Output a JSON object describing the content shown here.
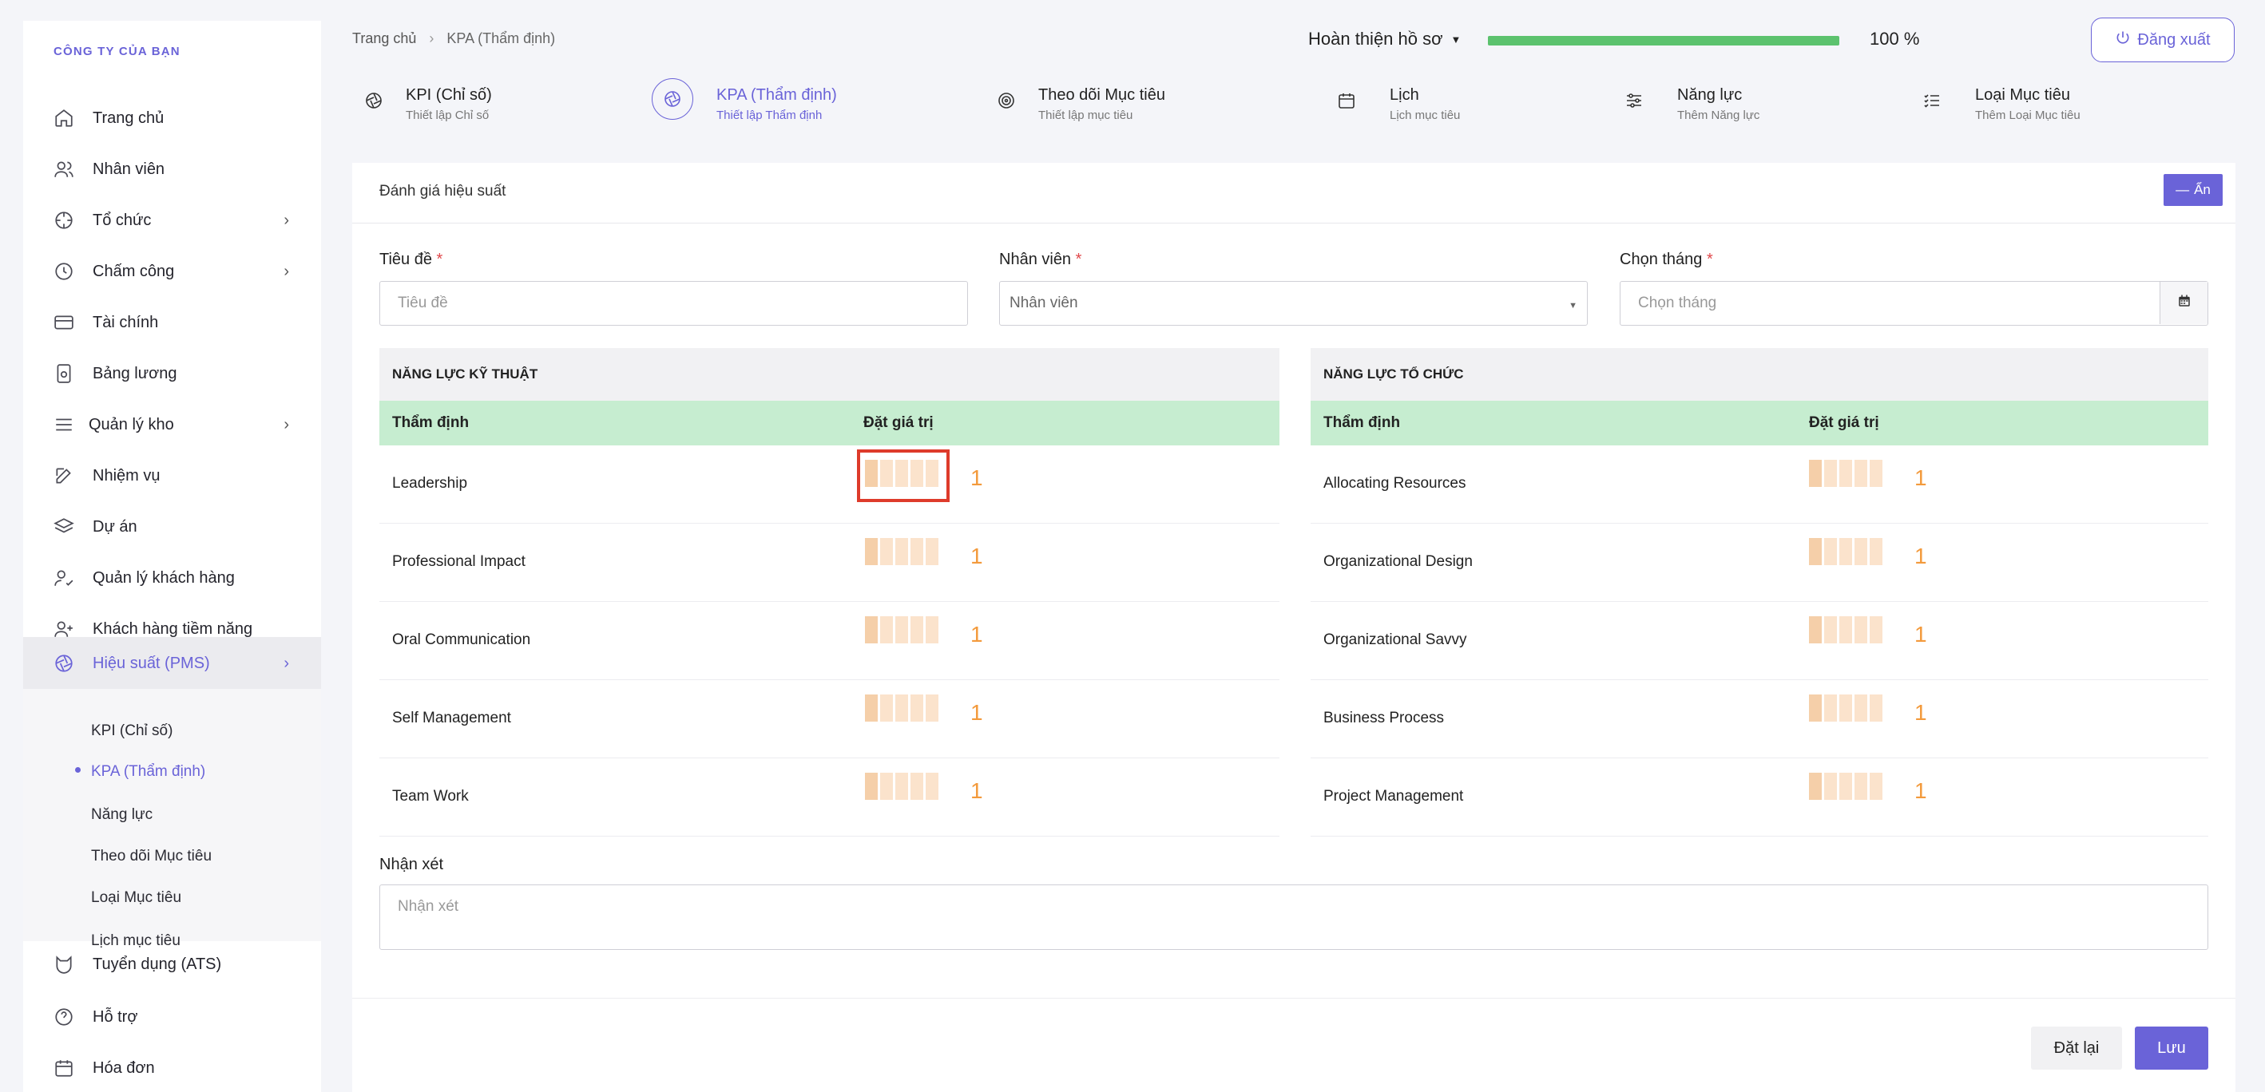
{
  "sidebar": {
    "company": "CÔNG TY CỦA BẠN",
    "items": [
      {
        "label": "Trang chủ"
      },
      {
        "label": "Nhân viên"
      },
      {
        "label": "Tổ chức"
      },
      {
        "label": "Chấm công"
      },
      {
        "label": "Tài chính"
      },
      {
        "label": "Bảng lương"
      },
      {
        "label": "Quản lý kho"
      },
      {
        "label": "Nhiệm vụ"
      },
      {
        "label": "Dự án"
      },
      {
        "label": "Quản lý khách hàng"
      },
      {
        "label": "Khách hàng tiềm năng"
      },
      {
        "label": "Hiệu suất (PMS)"
      },
      {
        "label": "Tuyển dụng (ATS)"
      },
      {
        "label": "Hỗ trợ"
      },
      {
        "label": "Hóa đơn"
      }
    ],
    "submenu": [
      {
        "label": "KPI (Chỉ số)"
      },
      {
        "label": "KPA (Thẩm định)"
      },
      {
        "label": "Năng lực"
      },
      {
        "label": "Theo dõi Mục tiêu"
      },
      {
        "label": "Loại Mục tiêu"
      },
      {
        "label": "Lịch mục tiêu"
      }
    ]
  },
  "header": {
    "breadcrumb": {
      "home": "Trang chủ",
      "current": "KPA (Thẩm định)"
    },
    "profile_label": "Hoàn thiện hồ sơ",
    "progress_value": 100,
    "progress_text": "100 %",
    "logout_label": "Đăng xuất"
  },
  "tabs": [
    {
      "title": "KPI (Chỉ số)",
      "subtitle": "Thiết lập Chỉ số"
    },
    {
      "title": "KPA (Thẩm định)",
      "subtitle": "Thiết lập Thẩm định"
    },
    {
      "title": "Theo dõi Mục tiêu",
      "subtitle": "Thiết lập mục tiêu"
    },
    {
      "title": "Lịch",
      "subtitle": "Lịch mục tiêu"
    },
    {
      "title": "Năng lực",
      "subtitle": "Thêm Năng lực"
    },
    {
      "title": "Loại Mục tiêu",
      "subtitle": "Thêm Loại Mục tiêu"
    }
  ],
  "card": {
    "title": "Đánh giá hiệu suất",
    "hide_label": "Ẩn",
    "fields": {
      "title_label": "Tiêu đề",
      "title_placeholder": "Tiêu đề",
      "employee_label": "Nhân viên",
      "employee_value": "Nhân viên",
      "month_label": "Chọn tháng",
      "month_placeholder": "Chọn tháng",
      "required_mark": "*"
    },
    "technical": {
      "heading": "NĂNG LỰC KỸ THUẬT",
      "col1": "Thẩm định",
      "col2": "Đặt giá trị",
      "rows": [
        {
          "name": "Leadership",
          "value": "1"
        },
        {
          "name": "Professional Impact",
          "value": "1"
        },
        {
          "name": "Oral Communication",
          "value": "1"
        },
        {
          "name": "Self Management",
          "value": "1"
        },
        {
          "name": "Team Work",
          "value": "1"
        }
      ]
    },
    "organizational": {
      "heading": "NĂNG LỰC TỔ CHỨC",
      "col1": "Thẩm định",
      "col2": "Đặt giá trị",
      "rows": [
        {
          "name": "Allocating Resources",
          "value": "1"
        },
        {
          "name": "Organizational Design",
          "value": "1"
        },
        {
          "name": "Organizational Savvy",
          "value": "1"
        },
        {
          "name": "Business Process",
          "value": "1"
        },
        {
          "name": "Project Management",
          "value": "1"
        }
      ]
    },
    "note_label": "Nhận xét",
    "note_placeholder": "Nhận xét",
    "reset_label": "Đặt lại",
    "save_label": "Lưu"
  },
  "colors": {
    "accent": "#6a63d8",
    "progress": "#5cc26e",
    "rating": "#f39a3c",
    "highlight": "#de3b2b"
  }
}
